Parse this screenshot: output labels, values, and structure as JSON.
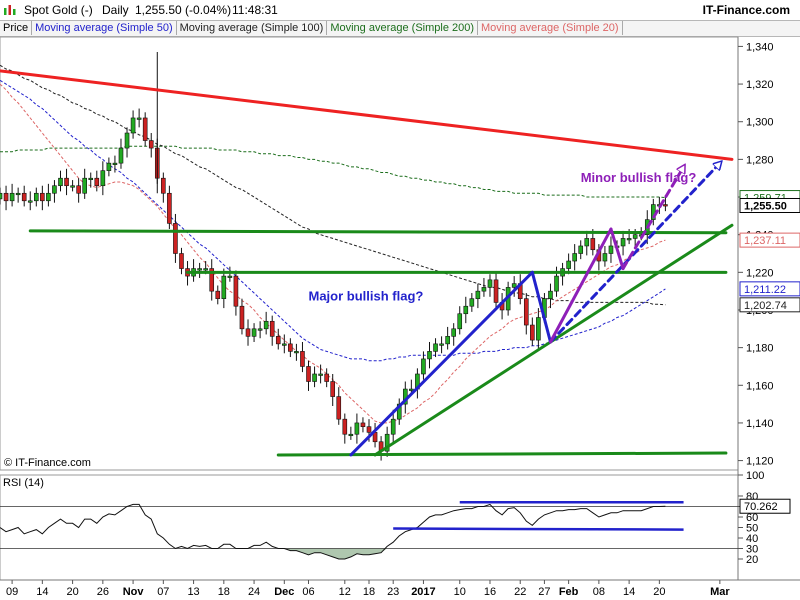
{
  "header": {
    "instrument": "Spot Gold (-)",
    "period": "Daily",
    "quote": "1,255.50 (-0.04%)",
    "time": "11:48:31",
    "brand": "IT-Finance.com"
  },
  "legend": [
    {
      "label": "Price",
      "color": "#000000"
    },
    {
      "label": "Moving average (Simple 50)",
      "color": "#2222cc"
    },
    {
      "label": "Moving average (Simple 100)",
      "color": "#222222"
    },
    {
      "label": "Moving average (Simple 200)",
      "color": "#1c6e1c"
    },
    {
      "label": "Moving average (Simple 20)",
      "color": "#dd6666"
    }
  ],
  "watermark": "© IT-Finance.com",
  "colors": {
    "up": "#22aa22",
    "down": "#cc2222",
    "upWick": "#111111",
    "ma50": "#2222cc",
    "ma100": "#222222",
    "ma200": "#1c6e1c",
    "ma20": "#dd6666"
  },
  "chart_data": {
    "type": "candlestick",
    "ylim": [
      1115,
      1345
    ],
    "xlim": [
      0,
      122
    ],
    "yticks": [
      1120,
      1140,
      1160,
      1180,
      1200,
      1220,
      1240,
      1260,
      1280,
      1300,
      1320,
      1340
    ],
    "ytick_labels": [
      "1,120",
      "1,140",
      "1,160",
      "1,180",
      "1,200",
      "1,220",
      "1,240",
      "1,260",
      "1,280",
      "1,300",
      "1,320",
      "1,340"
    ],
    "xticks": [
      {
        "idx": 2,
        "label": "09"
      },
      {
        "idx": 7,
        "label": "14"
      },
      {
        "idx": 12,
        "label": "20"
      },
      {
        "idx": 17,
        "label": "26"
      },
      {
        "idx": 22,
        "label": "Nov"
      },
      {
        "idx": 27,
        "label": "07"
      },
      {
        "idx": 32,
        "label": "13"
      },
      {
        "idx": 37,
        "label": "18"
      },
      {
        "idx": 42,
        "label": "24"
      },
      {
        "idx": 47,
        "label": "Dec"
      },
      {
        "idx": 51,
        "label": "06"
      },
      {
        "idx": 57,
        "label": "12"
      },
      {
        "idx": 61,
        "label": "18"
      },
      {
        "idx": 65,
        "label": "23"
      },
      {
        "idx": 70,
        "label": "2017"
      },
      {
        "idx": 76,
        "label": "10"
      },
      {
        "idx": 81,
        "label": "16"
      },
      {
        "idx": 86,
        "label": "22"
      },
      {
        "idx": 90,
        "label": "27"
      },
      {
        "idx": 94,
        "label": "Feb"
      },
      {
        "idx": 99,
        "label": "08"
      },
      {
        "idx": 104,
        "label": "14"
      },
      {
        "idx": 109,
        "label": "20"
      },
      {
        "idx": 119,
        "label": "Mar"
      }
    ],
    "close": [
      1262,
      1258,
      1262,
      1262,
      1258,
      1258,
      1262,
      1258,
      1262,
      1266,
      1270,
      1266,
      1266,
      1262,
      1270,
      1270,
      1266,
      1274,
      1278,
      1278,
      1286,
      1294,
      1302,
      1302,
      1290,
      1286,
      1270,
      1262,
      1246,
      1230,
      1222,
      1218,
      1222,
      1222,
      1222,
      1210,
      1206,
      1218,
      1218,
      1202,
      1190,
      1186,
      1190,
      1190,
      1194,
      1186,
      1182,
      1182,
      1178,
      1178,
      1170,
      1162,
      1166,
      1166,
      1162,
      1154,
      1142,
      1134,
      1134,
      1140,
      1138,
      1135,
      1130,
      1125,
      1134,
      1142,
      1150,
      1158,
      1158,
      1166,
      1174,
      1178,
      1182,
      1182,
      1186,
      1190,
      1198,
      1202,
      1206,
      1210,
      1212,
      1216,
      1204,
      1200,
      1212,
      1214,
      1206,
      1192,
      1184,
      1196,
      1206,
      1210,
      1218,
      1222,
      1226,
      1230,
      1234,
      1238,
      1232,
      1226,
      1230,
      1234,
      1234,
      1238,
      1238,
      1240,
      1240,
      1248,
      1256,
      1256,
      1255.5
    ],
    "ma20": [
      1320,
      1317,
      1313,
      1310,
      1306,
      1302,
      1298,
      1294,
      1290,
      1286,
      1282,
      1278,
      1274,
      1270,
      1267,
      1266,
      1265,
      1266,
      1267,
      1268,
      1268,
      1267,
      1266,
      1264,
      1261,
      1258,
      1255,
      1251,
      1247,
      1243,
      1240,
      1236,
      1232,
      1228,
      1225,
      1221,
      1217,
      1213,
      1210,
      1208,
      1205,
      1203,
      1200,
      1196,
      1193,
      1190,
      1187,
      1184,
      1181,
      1178,
      1176,
      1173,
      1171,
      1169,
      1166,
      1163,
      1160,
      1156,
      1153,
      1150,
      1147,
      1144,
      1141,
      1140,
      1140,
      1141,
      1142,
      1144,
      1146,
      1148,
      1151,
      1153,
      1156,
      1160,
      1163,
      1167,
      1170,
      1174,
      1177,
      1180,
      1183,
      1186,
      1188,
      1190,
      1193,
      1195,
      1196,
      1197,
      1198,
      1199,
      1200,
      1202,
      1205,
      1207,
      1209,
      1211,
      1213,
      1215,
      1217,
      1219,
      1221,
      1223,
      1224,
      1226,
      1228,
      1230,
      1232,
      1233,
      1234,
      1236,
      1237.11
    ],
    "ma50": [
      1322,
      1320,
      1318,
      1316,
      1314,
      1312,
      1309,
      1307,
      1304,
      1301,
      1298,
      1295,
      1292,
      1290,
      1287,
      1285,
      1282,
      1280,
      1277,
      1275,
      1273,
      1270,
      1268,
      1265,
      1262,
      1259,
      1256,
      1253,
      1250,
      1247,
      1244,
      1241,
      1238,
      1235,
      1233,
      1230,
      1227,
      1224,
      1221,
      1218,
      1215,
      1212,
      1209,
      1206,
      1203,
      1200,
      1197,
      1194,
      1191,
      1188,
      1185,
      1183,
      1181,
      1179,
      1178,
      1177,
      1176,
      1175,
      1174,
      1174,
      1174,
      1173,
      1173,
      1173,
      1174,
      1174,
      1175,
      1175,
      1176,
      1176,
      1176,
      1176,
      1176,
      1176,
      1176,
      1176,
      1177,
      1177,
      1177,
      1177,
      1178,
      1178,
      1178,
      1179,
      1179,
      1180,
      1180,
      1180,
      1181,
      1181,
      1182,
      1183,
      1184,
      1185,
      1186,
      1187,
      1188,
      1189,
      1190,
      1191,
      1193,
      1194,
      1196,
      1197,
      1199,
      1201,
      1203,
      1205,
      1207,
      1209,
      1211.22
    ],
    "ma100": [
      1330,
      1328,
      1327,
      1325,
      1323,
      1322,
      1320,
      1318,
      1317,
      1315,
      1314,
      1312,
      1310,
      1309,
      1307,
      1306,
      1304,
      1303,
      1301,
      1300,
      1298,
      1296,
      1295,
      1293,
      1292,
      1290,
      1288,
      1287,
      1285,
      1283,
      1282,
      1280,
      1278,
      1276,
      1275,
      1273,
      1271,
      1269,
      1267,
      1265,
      1264,
      1262,
      1260,
      1258,
      1256,
      1254,
      1252,
      1250,
      1248,
      1246,
      1244,
      1243,
      1241,
      1240,
      1239,
      1238,
      1237,
      1236,
      1235,
      1234,
      1233,
      1232,
      1231,
      1230,
      1229,
      1228,
      1227,
      1226,
      1225,
      1224,
      1223,
      1222,
      1221,
      1220,
      1219,
      1218,
      1217,
      1216,
      1215,
      1214,
      1213,
      1212,
      1212,
      1211,
      1210,
      1209,
      1209,
      1208,
      1207,
      1207,
      1206,
      1206,
      1205,
      1205,
      1205,
      1204,
      1204,
      1204,
      1204,
      1204,
      1204,
      1204,
      1204,
      1204,
      1204,
      1204,
      1204,
      1204,
      1203,
      1203,
      1202.74
    ],
    "ma200": [
      1284,
      1284,
      1284,
      1285,
      1285,
      1285,
      1285,
      1285,
      1286,
      1286,
      1286,
      1286,
      1286,
      1286,
      1286,
      1286,
      1286,
      1286,
      1286,
      1286,
      1286,
      1287,
      1287,
      1287,
      1287,
      1287,
      1287,
      1287,
      1287,
      1287,
      1286,
      1286,
      1286,
      1286,
      1286,
      1286,
      1285,
      1285,
      1285,
      1285,
      1284,
      1284,
      1284,
      1283,
      1283,
      1283,
      1282,
      1282,
      1282,
      1281,
      1281,
      1280,
      1280,
      1279,
      1279,
      1278,
      1278,
      1277,
      1276,
      1276,
      1275,
      1275,
      1274,
      1273,
      1273,
      1272,
      1271,
      1271,
      1270,
      1270,
      1269,
      1269,
      1268,
      1268,
      1267,
      1267,
      1266,
      1266,
      1265,
      1265,
      1264,
      1264,
      1263,
      1263,
      1263,
      1262,
      1262,
      1262,
      1262,
      1262,
      1261,
      1261,
      1261,
      1261,
      1261,
      1261,
      1261,
      1260,
      1260,
      1260,
      1260,
      1260,
      1260,
      1260,
      1260,
      1260,
      1260,
      1260,
      1260,
      1260,
      1259.71
    ],
    "price_labels": [
      {
        "value": 1259.71,
        "text": "1,259.71",
        "color": "#1c6e1c",
        "bold": false
      },
      {
        "value": 1255.5,
        "text": "1,255.50",
        "color": "#000000",
        "bold": true
      },
      {
        "value": 1237.11,
        "text": "1,237.11",
        "color": "#dd6666",
        "bold": false
      },
      {
        "value": 1211.22,
        "text": "1,211.22",
        "color": "#2222cc",
        "bold": false
      },
      {
        "value": 1202.74,
        "text": "1,202.74",
        "color": "#222222",
        "bold": false
      }
    ],
    "annotations": [
      {
        "text": "Minor bullish flag?",
        "color": "#8e1fb8",
        "idx": 96,
        "value": 1268
      },
      {
        "text": "Major bullish flag?",
        "color": "#2222cc",
        "idx": 51,
        "value": 1205
      }
    ],
    "trendlines": [
      {
        "name": "resistance-line",
        "color": "#ee2222",
        "width": 3,
        "dash": false,
        "from": [
          0,
          1327
        ],
        "to": [
          121,
          1280
        ]
      },
      {
        "name": "support-line-upper",
        "color": "#1a8a1a",
        "width": 3,
        "dash": false,
        "from": [
          5,
          1242
        ],
        "to": [
          120,
          1241
        ]
      },
      {
        "name": "support-line-middle",
        "color": "#1a8a1a",
        "width": 3,
        "dash": false,
        "from": [
          31,
          1220
        ],
        "to": [
          120,
          1220
        ]
      },
      {
        "name": "support-line-bottom",
        "color": "#1a8a1a",
        "width": 3,
        "dash": false,
        "from": [
          46,
          1123
        ],
        "to": [
          120,
          1124
        ]
      },
      {
        "name": "rising-trendline",
        "color": "#1a8a1a",
        "width": 3,
        "dash": false,
        "from": [
          62,
          1123
        ],
        "to": [
          121,
          1245
        ]
      },
      {
        "name": "major-flagpole",
        "color": "#2222cc",
        "width": 3,
        "dash": false,
        "from": [
          58,
          1123
        ],
        "to": [
          88,
          1220
        ]
      },
      {
        "name": "major-flag-down",
        "color": "#2222cc",
        "width": 3,
        "dash": false,
        "from": [
          88,
          1220
        ],
        "to": [
          91,
          1183
        ]
      },
      {
        "name": "major-flag-projection",
        "color": "#2222cc",
        "width": 3,
        "dash": true,
        "from": [
          91,
          1183
        ],
        "to": [
          119,
          1278
        ]
      },
      {
        "name": "minor-flagpole",
        "color": "#8e1fb8",
        "width": 3,
        "dash": false,
        "from": [
          91,
          1183
        ],
        "to": [
          101,
          1243
        ]
      },
      {
        "name": "minor-flag-down",
        "color": "#8e1fb8",
        "width": 3,
        "dash": false,
        "from": [
          101,
          1243
        ],
        "to": [
          103,
          1222
        ]
      },
      {
        "name": "minor-flag-projection",
        "color": "#8e1fb8",
        "width": 3,
        "dash": true,
        "from": [
          103,
          1222
        ],
        "to": [
          113,
          1276
        ]
      }
    ],
    "rsi": {
      "label": "RSI (14)",
      "ylim": [
        0,
        100
      ],
      "yticks": [
        20,
        30,
        40,
        50,
        60,
        70,
        80,
        100
      ],
      "value": 70.262,
      "value_text": "70.262",
      "values": [
        50,
        46,
        48,
        50,
        44,
        46,
        48,
        44,
        50,
        54,
        58,
        54,
        54,
        50,
        58,
        58,
        54,
        60,
        63,
        62,
        66,
        70,
        72,
        72,
        62,
        58,
        44,
        40,
        34,
        30,
        32,
        30,
        33,
        32,
        33,
        30,
        30,
        34,
        34,
        30,
        30,
        30,
        33,
        33,
        36,
        32,
        30,
        30,
        28,
        28,
        26,
        24,
        26,
        26,
        24,
        22,
        20,
        20,
        22,
        25,
        24,
        24,
        25,
        26,
        32,
        36,
        42,
        46,
        48,
        50,
        55,
        60,
        62,
        62,
        64,
        66,
        67,
        68,
        68,
        70,
        70,
        72,
        66,
        62,
        68,
        69,
        64,
        56,
        52,
        58,
        62,
        64,
        66,
        66,
        67,
        67,
        68,
        68,
        64,
        60,
        62,
        64,
        64,
        66,
        66,
        66,
        66,
        68,
        70,
        70,
        70.262
      ],
      "levels": [
        {
          "name": "rsi-upper-line",
          "color": "#2222cc",
          "from": [
            76,
            74
          ],
          "to": [
            113,
            74
          ]
        },
        {
          "name": "rsi-lower-line",
          "color": "#2222cc",
          "from": [
            65,
            49
          ],
          "to": [
            113,
            48
          ]
        }
      ]
    }
  }
}
